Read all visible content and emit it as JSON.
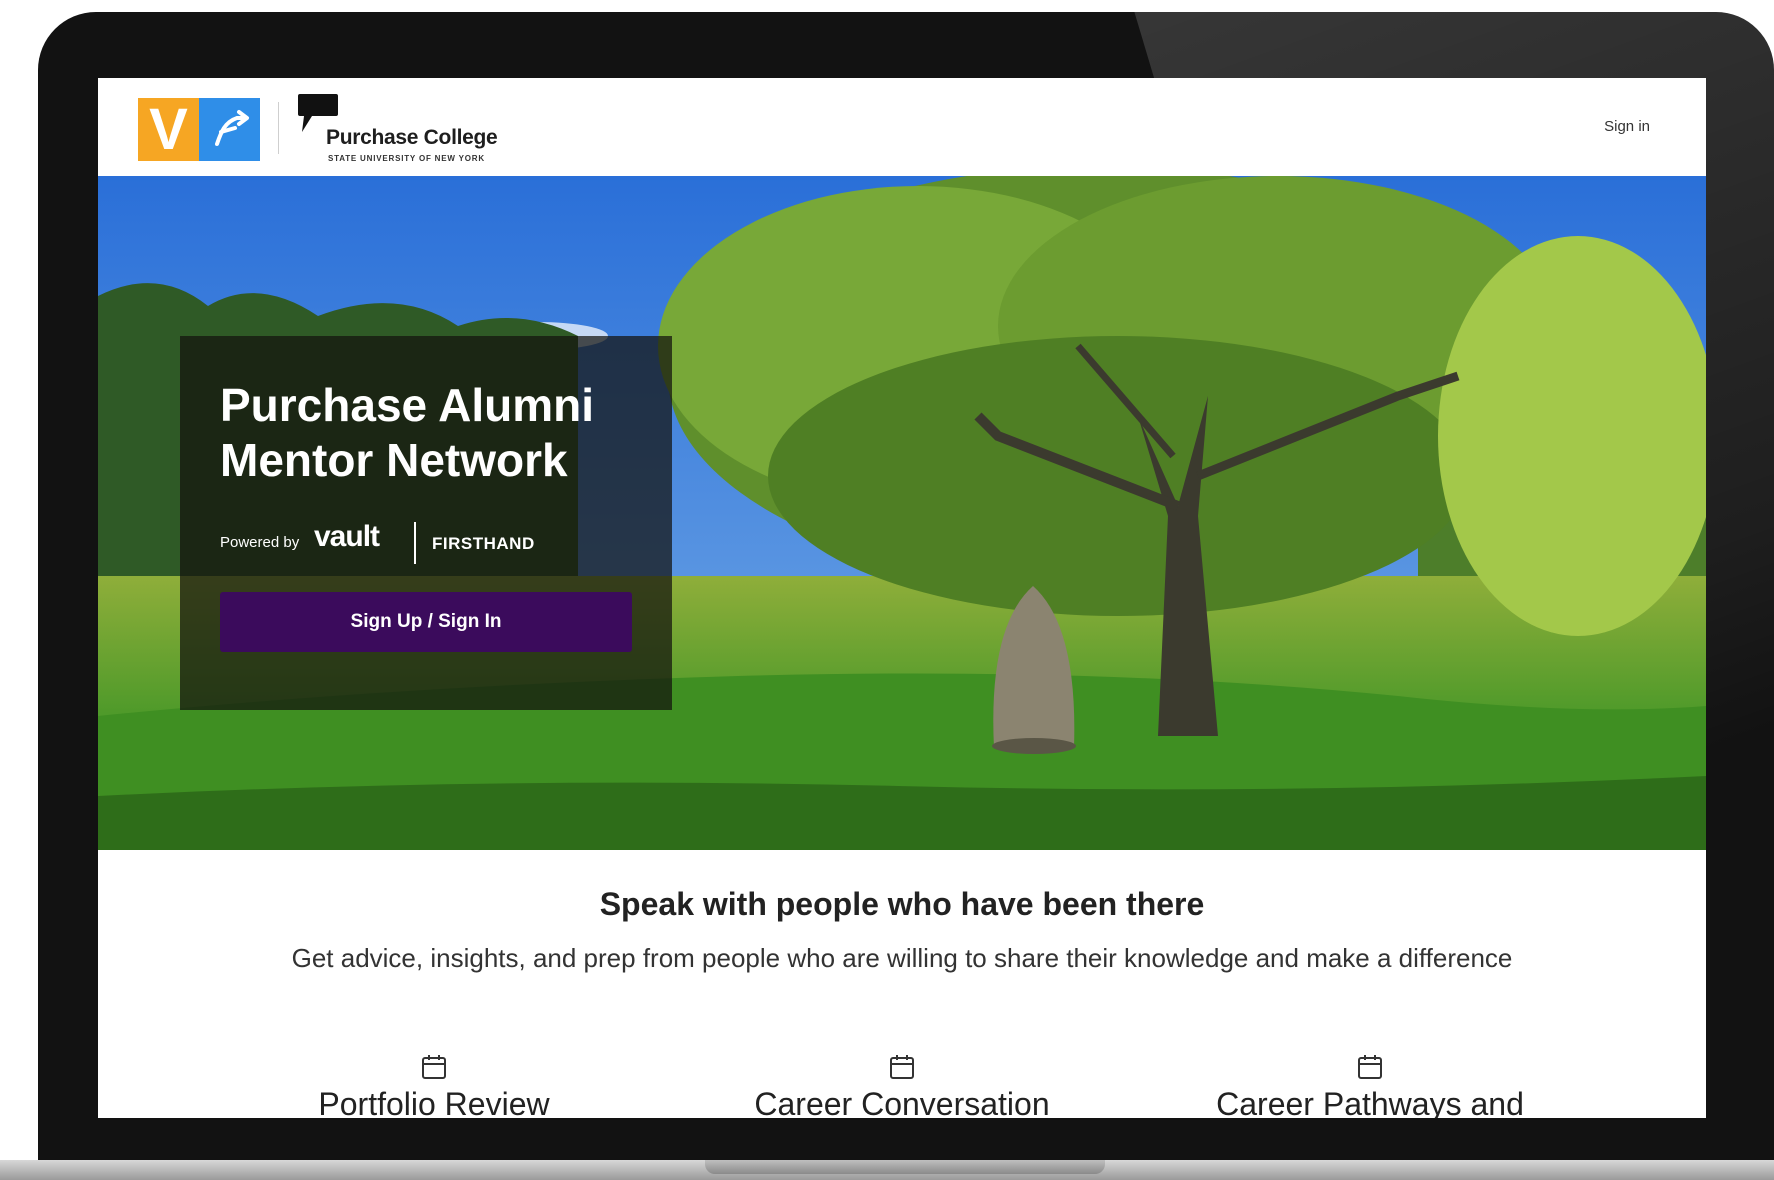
{
  "header": {
    "vf_logo_letter": "V",
    "college_name": "Purchase College",
    "college_subtitle": "STATE UNIVERSITY OF NEW YORK",
    "signin_label": "Sign in"
  },
  "hero": {
    "title": "Purchase Alumni Mentor Network",
    "powered_by": "Powered by",
    "vault_brand": "vault",
    "firsthand_brand": "FIRSTHAND",
    "cta_label": "Sign Up / Sign In"
  },
  "info": {
    "title": "Speak with people who have been there",
    "subtitle": "Get advice, insights, and prep from people who are willing to share their knowledge and make a difference",
    "features": [
      {
        "label": "Portfolio Review",
        "icon": "calendar-icon"
      },
      {
        "label": "Career Conversation",
        "icon": "calendar-icon"
      },
      {
        "label": "Career Pathways and",
        "icon": "calendar-icon"
      }
    ]
  },
  "colors": {
    "cta_background": "#3b0b5c",
    "vf_orange": "#f6a623",
    "vf_blue": "#2f8ee8",
    "device_frame": "#121212"
  }
}
